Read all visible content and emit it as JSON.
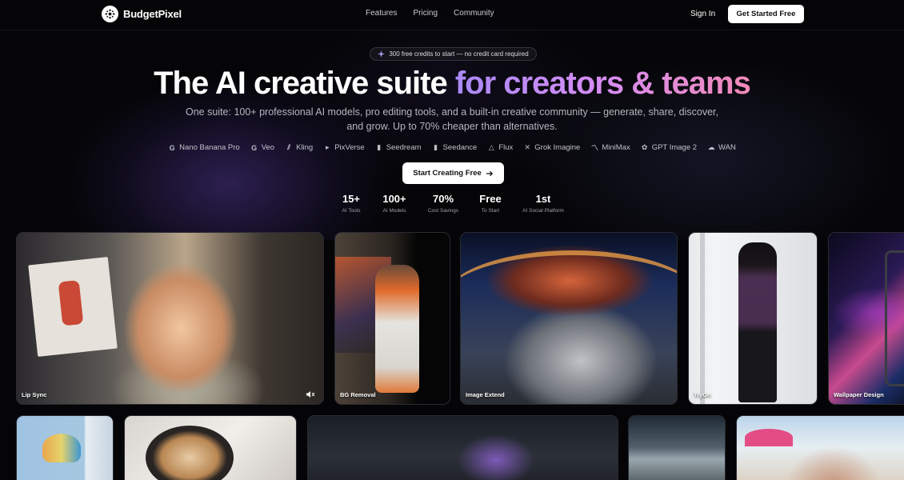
{
  "nav": {
    "brand": "BudgetPixel",
    "links": [
      "Features",
      "Pricing",
      "Community"
    ],
    "sign_in": "Sign In",
    "cta": "Get Started Free"
  },
  "hero": {
    "badge": "300 free credits to start — no credit card required",
    "headline_plain": "The AI creative suite",
    "headline_accent": "for creators & teams",
    "subline": "One suite: 100+ professional AI models, pro editing tools, and a built-in creative community — generate, share, discover, and grow. Up to 70% cheaper than alternatives.",
    "models": [
      {
        "name": "Nano Banana Pro",
        "icon": "google-icon"
      },
      {
        "name": "Veo",
        "icon": "google-icon"
      },
      {
        "name": "Kling",
        "icon": "kling-icon"
      },
      {
        "name": "PixVerse",
        "icon": "pixverse-icon"
      },
      {
        "name": "Seedream",
        "icon": "bars-icon"
      },
      {
        "name": "Seedance",
        "icon": "bars-icon"
      },
      {
        "name": "Flux",
        "icon": "flux-icon"
      },
      {
        "name": "Grok Imagine",
        "icon": "x-icon"
      },
      {
        "name": "MiniMax",
        "icon": "minimax-icon"
      },
      {
        "name": "GPT Image 2",
        "icon": "openai-icon"
      },
      {
        "name": "WAN",
        "icon": "cloud-icon"
      }
    ],
    "start_button": "Start Creating Free",
    "stats": [
      {
        "value": "15+",
        "label": "AI Tools"
      },
      {
        "value": "100+",
        "label": "AI Models"
      },
      {
        "value": "70%",
        "label": "Cost Savings"
      },
      {
        "value": "Free",
        "label": "To Start"
      },
      {
        "value": "1st",
        "label": "AI Social Platform"
      }
    ]
  },
  "gallery": {
    "row1": [
      "Lip Sync",
      "BG Removal",
      "Image Extend",
      "TryOn",
      "Wallpaper Design"
    ]
  },
  "colors": {
    "background": "#050507",
    "accent_start": "#a98af7",
    "accent_end": "#f28ab8"
  }
}
